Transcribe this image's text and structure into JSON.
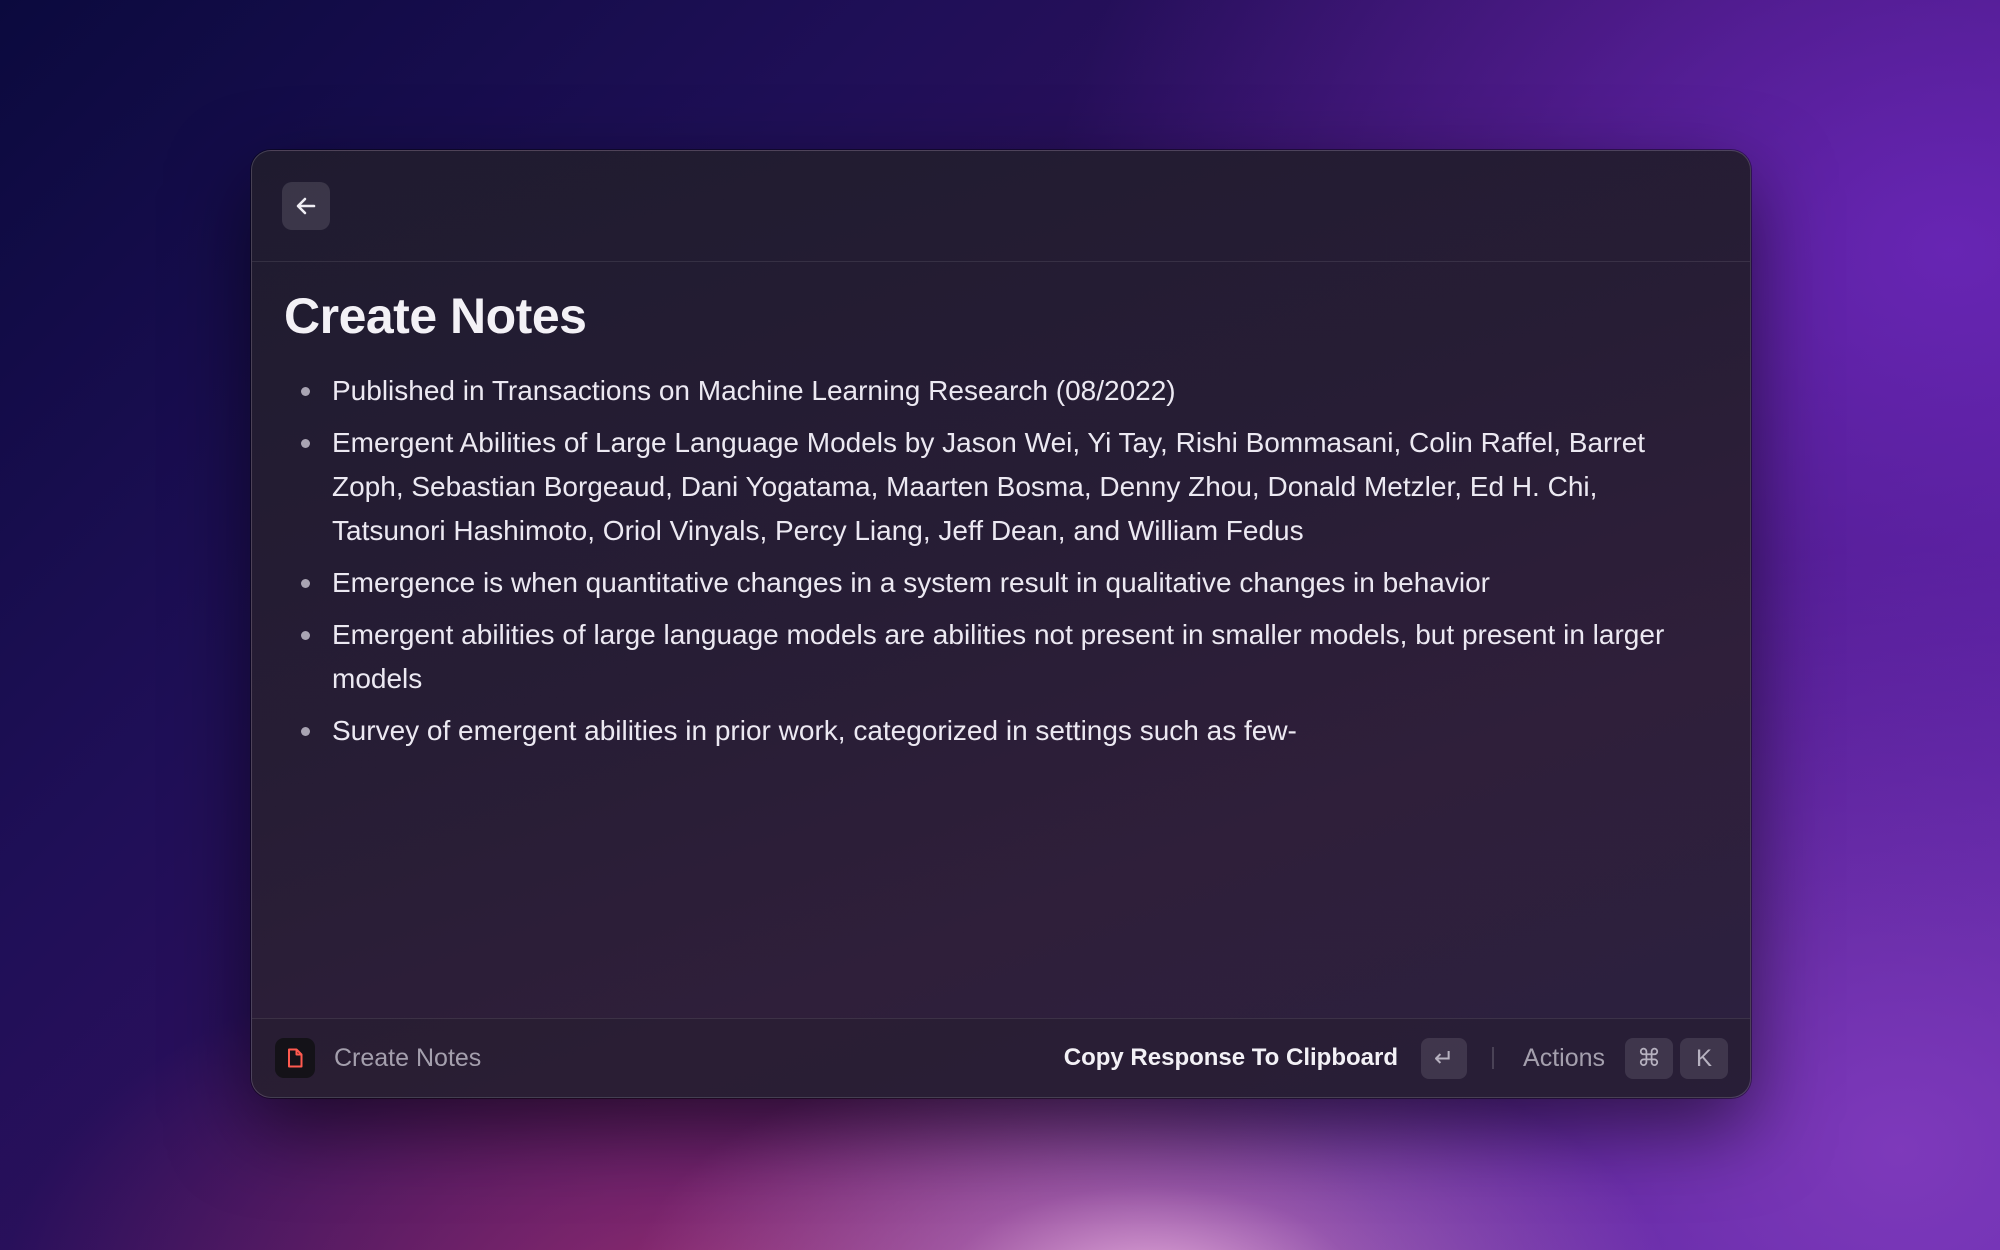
{
  "window": {
    "title": "Create Notes",
    "notes": [
      "Published in Transactions on Machine Learning Research (08/2022)",
      "Emergent Abilities of Large Language Models by Jason Wei, Yi Tay, Rishi Bommasani, Colin Raffel, Barret Zoph, Sebastian Borgeaud, Dani Yogatama, Maarten Bosma, Denny Zhou, Donald Metzler, Ed H. Chi, Tatsunori Hashimoto, Oriol Vinyals, Percy Liang, Jeff Dean, and William Fedus",
      "Emergence is when quantitative changes in a system result in qualitative changes in behavior",
      "Emergent abilities of large language models are abilities not present in smaller models, but present in larger models",
      "Survey of emergent abilities in prior work, categorized in settings such as few-"
    ]
  },
  "toolbar": {
    "back_icon": "arrow-left-icon"
  },
  "footer": {
    "command_icon": "document-icon",
    "command_icon_color": "#ff5a4f",
    "command_name": "Create Notes",
    "primary_action": "Copy Response To Clipboard",
    "enter_key": "↵",
    "actions_label": "Actions",
    "cmd_key": "⌘",
    "k_key": "K"
  }
}
